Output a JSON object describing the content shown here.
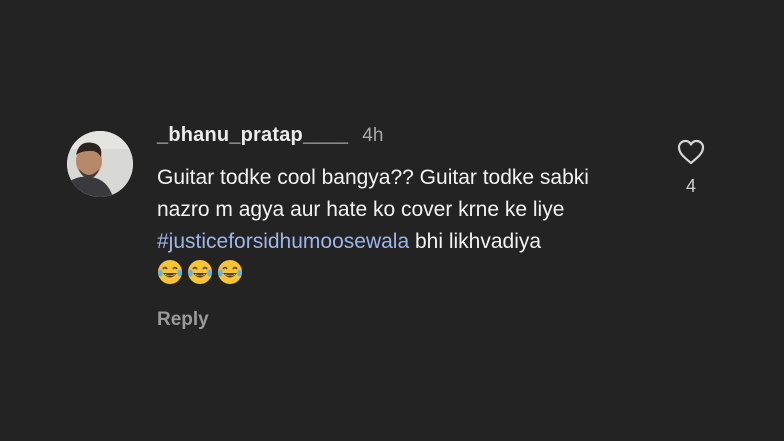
{
  "comment": {
    "username": "_bhanu_pratap____",
    "time": "4h",
    "text_part1": "Guitar todke cool bangya?? Guitar todke sabki nazro m agya aur hate ko cover krne ke liye ",
    "hashtag": "#justiceforsidhumoosewala",
    "text_part2": " bhi likhvadiya",
    "emojis": [
      "😂",
      "😂",
      "😂"
    ],
    "reply_label": "Reply"
  },
  "like": {
    "icon": "heart-icon",
    "count": "4"
  },
  "colors": {
    "background": "#232323",
    "hashtag": "#9db6e8",
    "primary_text": "#f2f2f2",
    "secondary_text": "#a8a8a8"
  }
}
